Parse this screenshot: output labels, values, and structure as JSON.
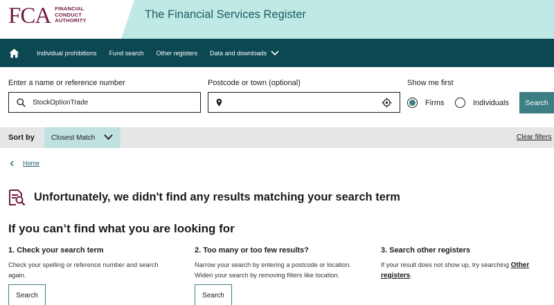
{
  "header": {
    "logo_mark": "FCA",
    "logo_lines": [
      "FINANCIAL",
      "CONDUCT",
      "AUTHORITY"
    ],
    "title": "The Financial Services Register",
    "band_color": "#bfe9e5",
    "brand_color": "#701b45"
  },
  "nav": {
    "background": "#0b4852",
    "items": [
      {
        "label": "Individual prohibitions"
      },
      {
        "label": "Fund search"
      },
      {
        "label": "Other registers"
      },
      {
        "label": "Data and downloads",
        "has_dropdown": true
      }
    ]
  },
  "search": {
    "name_label": "Enter a name or reference number",
    "name_value": "StockOptionTrade",
    "postcode_label": "Postcode or town (optional)",
    "postcode_value": "",
    "show_first_label": "Show me first",
    "options": [
      {
        "label": "Firms",
        "selected": true
      },
      {
        "label": "Individuals",
        "selected": false
      }
    ],
    "button_label": "Search"
  },
  "sort": {
    "label": "Sort by",
    "value": "Closest Match",
    "clear_label": "Clear filters"
  },
  "breadcrumb": {
    "home_label": "Home"
  },
  "results": {
    "no_results_message": "Unfortunately, we didn't find any results matching your search term",
    "help_heading": "If you can’t find what you are looking for",
    "columns": [
      {
        "title": "1. Check your search term",
        "text": "Check your spelling or reference number and search again.",
        "button_label": "Search"
      },
      {
        "title": "2. Too many or too few results?",
        "text": "Narrow your search by entering a postcode or location. Widen your search by removing filters like location.",
        "button_label": "Search"
      },
      {
        "title": "3. Search other registers",
        "text_before": "If your result does not show up, try searching ",
        "link_label": "Other registers",
        "text_after": "."
      }
    ]
  }
}
